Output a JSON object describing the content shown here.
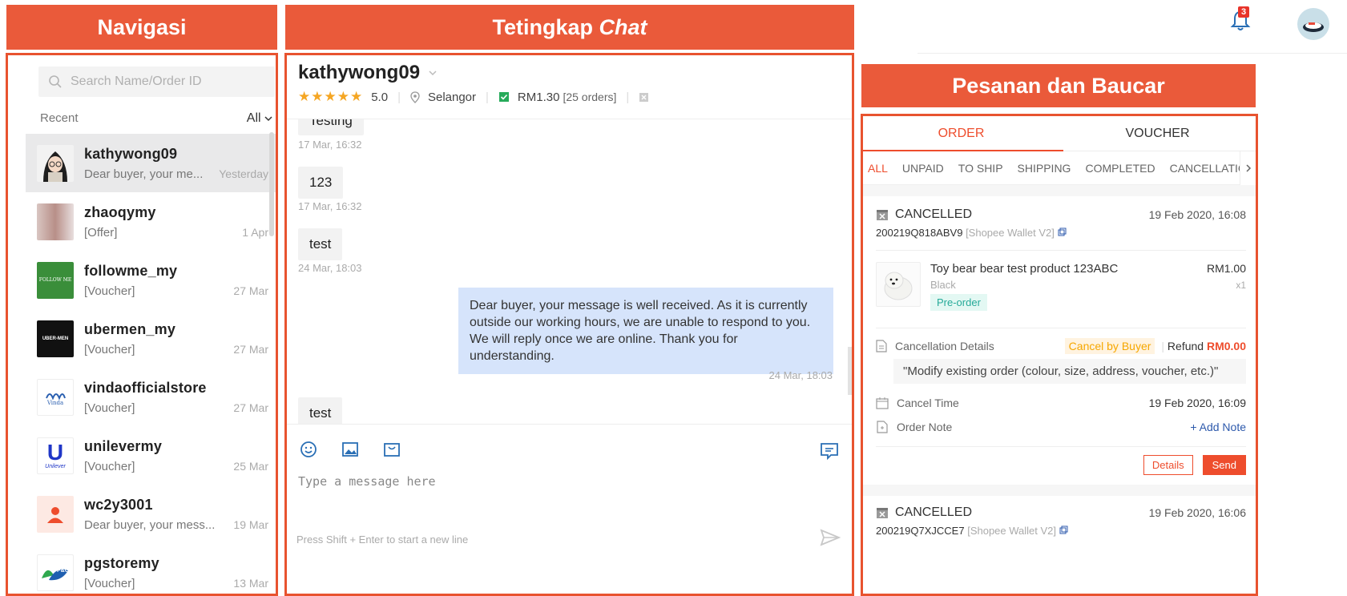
{
  "banners": {
    "nav": "Navigasi",
    "chat_main": "Tetingkap ",
    "chat_em": "Chat",
    "orders": "Pesanan dan Baucar"
  },
  "nav": {
    "search_placeholder": "Search Name/Order ID",
    "recent_label": "Recent",
    "filter_label": "All",
    "conversations": [
      {
        "name": "kathywong09",
        "message": "Dear buyer, your me...",
        "date": "Yesterday"
      },
      {
        "name": "zhaoqymy",
        "message": "[Offer]",
        "date": "1 Apr"
      },
      {
        "name": "followme_my",
        "message": "[Voucher]",
        "date": "27 Mar"
      },
      {
        "name": "ubermen_my",
        "message": "[Voucher]",
        "date": "27 Mar"
      },
      {
        "name": "vindaofficialstore",
        "message": "[Voucher]",
        "date": "27 Mar"
      },
      {
        "name": "unilevermy",
        "message": "[Voucher]",
        "date": "25 Mar"
      },
      {
        "name": "wc2y3001",
        "message": "Dear buyer, your mess...",
        "date": "19 Mar"
      },
      {
        "name": "pgstoremy",
        "message": "[Voucher]",
        "date": "13 Mar"
      }
    ],
    "avatar_texts": {
      "followme": "FOLLOW ME",
      "ubermen": "UBER-MEN",
      "vinda": "Vinda",
      "unilever": "Unilever",
      "pg": "P&G"
    }
  },
  "chat": {
    "username": "kathywong09",
    "rating": "5.0",
    "location": "Selangor",
    "spend": "RM1.30",
    "orders": "[25 orders]",
    "messages": {
      "m1_text": "Testing",
      "m1_time": "17 Mar, 16:32",
      "m2_text": "123",
      "m2_time": "17 Mar, 16:32",
      "m3_text": "test",
      "m3_time": "24 Mar, 18:03",
      "m4_text": "Dear buyer, your message is well received. As it is currently outside our working hours, we are unable to respond to you. We will reply once we are online. Thank you for understanding.",
      "m4_time": "24 Mar, 18:03",
      "m5_text": "test"
    },
    "input_placeholder": "Type a message here",
    "hint": "Press Shift + Enter to start a new line"
  },
  "header": {
    "notification_count": "3"
  },
  "orders": {
    "tabs": [
      "ORDER",
      "VOUCHER"
    ],
    "subtabs": [
      "ALL",
      "UNPAID",
      "TO SHIP",
      "SHIPPING",
      "COMPLETED",
      "CANCELLATIC"
    ],
    "order1": {
      "status": "CANCELLED",
      "date": "19 Feb 2020, 16:08",
      "id": "200219Q818ABV9",
      "payment": "[Shopee Wallet V2]",
      "product_name": "Toy bear bear test product 123ABC",
      "variation": "Black",
      "tag": "Pre-order",
      "price": "RM1.00",
      "qty": "x1",
      "cancel_label": "Cancellation Details",
      "cancel_by": "Cancel by Buyer",
      "refund_label": "Refund",
      "refund_amount": "RM0.00",
      "reason": "\"Modify existing order (colour, size, address, voucher, etc.)\"",
      "cancel_time_label": "Cancel Time",
      "cancel_time": "19 Feb 2020, 16:09",
      "note_label": "Order Note",
      "add_note": "+ Add Note",
      "details_btn": "Details",
      "send_btn": "Send"
    },
    "order2": {
      "status": "CANCELLED",
      "date": "19 Feb 2020, 16:06",
      "id": "200219Q7XJCCE7",
      "payment": "[Shopee Wallet V2]"
    }
  },
  "colors": {
    "accent": "#ee4d2d",
    "banner": "#ea5a3a",
    "outbound_bubble": "#d6e4fb",
    "star": "#f5a623",
    "pre_order": "#26aa99"
  }
}
